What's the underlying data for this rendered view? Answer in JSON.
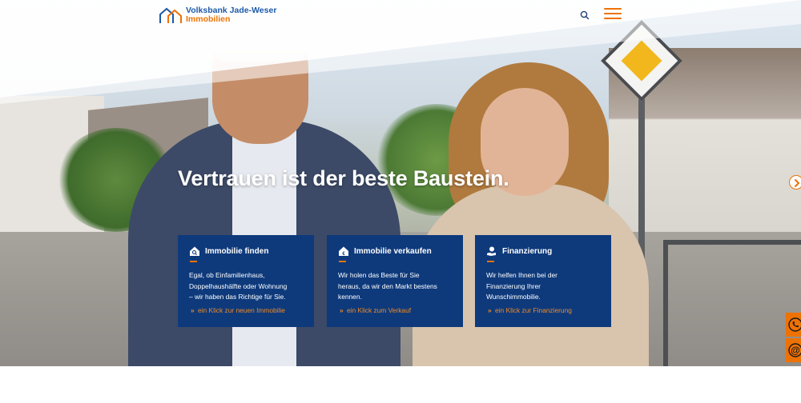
{
  "header": {
    "logo_line1": "Volksbank Jade-Weser",
    "logo_line2": "Immobilien",
    "search_icon": "search-icon",
    "menu_icon": "hamburger-menu-icon"
  },
  "hero": {
    "headline": "Vertrauen ist der beste Baustein.",
    "next_icon": "chevron-right-icon"
  },
  "cards": [
    {
      "icon": "house-search-icon",
      "title": "Immobilie finden",
      "lines": [
        "Egal, ob Einfamilienhaus,",
        "Doppelhaushälfte oder Wohnung",
        "– wir haben das Richtige für Sie."
      ],
      "link": "ein Klick zur neuen Immobilie"
    },
    {
      "icon": "house-euro-icon",
      "title": "Immobilie verkaufen",
      "lines": [
        "Wir holen das Beste für Sie",
        "heraus, da wir den Markt bestens",
        "kennen."
      ],
      "link": "ein Klick zum Verkauf"
    },
    {
      "icon": "hand-coin-icon",
      "title": "Finanzierung",
      "lines": [
        "Wir helfen Ihnen bei der",
        "Finanzierung Ihrer",
        "Wunschimmobilie."
      ],
      "link": "ein Klick zur Finanzierung"
    }
  ],
  "contact": {
    "phone_icon": "phone-icon",
    "email_icon": "at-sign-icon"
  },
  "colors": {
    "brand_blue": "#0e3a7c",
    "logo_blue": "#1d5aa8",
    "accent_orange": "#ee7203"
  }
}
